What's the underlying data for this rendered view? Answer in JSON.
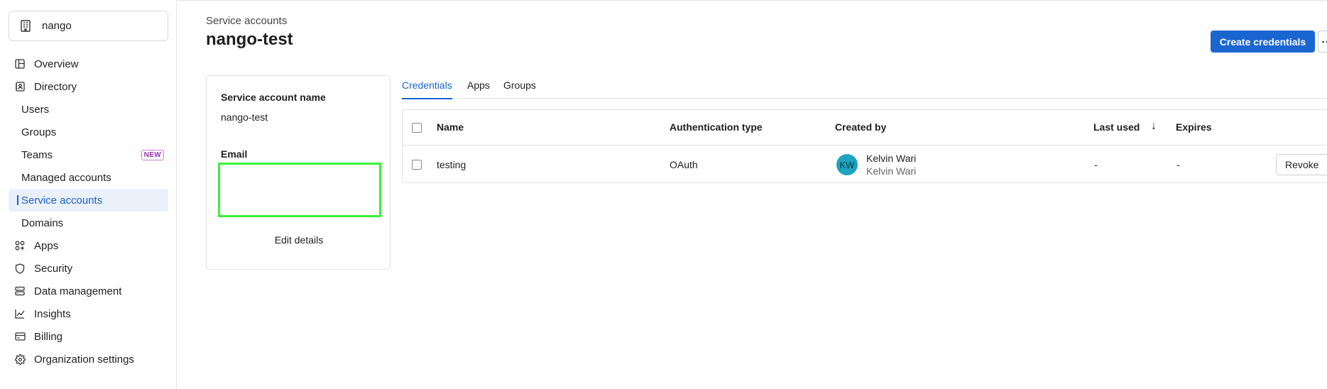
{
  "sidebar": {
    "org_name": "nango",
    "items": [
      {
        "label": "Overview",
        "icon": "layout-icon"
      },
      {
        "label": "Directory",
        "icon": "contacts-icon"
      },
      {
        "label": "Users"
      },
      {
        "label": "Groups"
      },
      {
        "label": "Teams",
        "badge": "NEW"
      },
      {
        "label": "Managed accounts"
      },
      {
        "label": "Service accounts",
        "active": true
      },
      {
        "label": "Domains"
      },
      {
        "label": "Apps",
        "icon": "apps-icon"
      },
      {
        "label": "Security",
        "icon": "shield-icon"
      },
      {
        "label": "Data management",
        "icon": "database-icon"
      },
      {
        "label": "Insights",
        "icon": "chart-icon"
      },
      {
        "label": "Billing",
        "icon": "card-icon"
      },
      {
        "label": "Organization settings",
        "icon": "gear-icon"
      }
    ]
  },
  "header": {
    "breadcrumb": "Service accounts",
    "title": "nango-test",
    "primary_button": "Create credentials",
    "more_button": "⋯"
  },
  "details": {
    "name_label": "Service account name",
    "name_value": "nango-test",
    "email_label": "Email",
    "edit_button": "Edit details"
  },
  "tabs": [
    {
      "label": "Credentials",
      "active": true
    },
    {
      "label": "Apps"
    },
    {
      "label": "Groups"
    }
  ],
  "table": {
    "columns": [
      "Name",
      "Authentication type",
      "Created by",
      "Last used",
      "Expires"
    ],
    "sort_icon": "↓",
    "rows": [
      {
        "name": "testing",
        "auth_type": "OAuth",
        "creator_initials": "KW",
        "creator_name": "Kelvin Wari",
        "creator_sub": "Kelvin Wari",
        "last_used": "-",
        "expires": "-",
        "action": "Revoke"
      }
    ]
  },
  "colors": {
    "accent": "#1a66d1",
    "active_bg": "#eaf1fb",
    "avatar": "#1ea3c1",
    "highlight": "#3af23a"
  }
}
